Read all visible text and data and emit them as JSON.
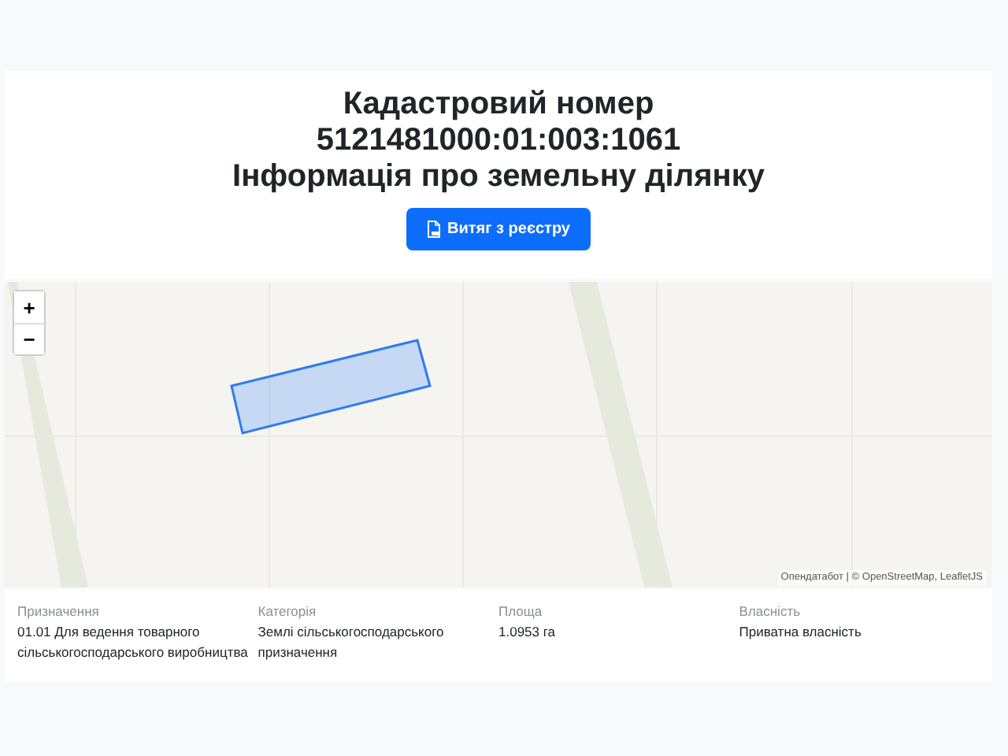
{
  "header": {
    "title_lines": [
      "Кадастровий номер",
      "5121481000:01:003:1061",
      "Інформація про земельну ділянку"
    ],
    "button": "Витяг з реєстру"
  },
  "map": {
    "kind": "picture",
    "zoom_in": "+",
    "zoom_out": "−",
    "attribution": "Опендатабот | © OpenStreetMap, LeafletJS"
  },
  "details": [
    {
      "label": "Призначення",
      "value": "01.01 Для ведення товарного сільськогосподарського виробництва"
    },
    {
      "label": "Категорія",
      "value": "Землі сільськогосподарського призначення"
    },
    {
      "label": "Площа",
      "value": "1.0953 га"
    },
    {
      "label": "Власність",
      "value": "Приватна власність"
    }
  ]
}
